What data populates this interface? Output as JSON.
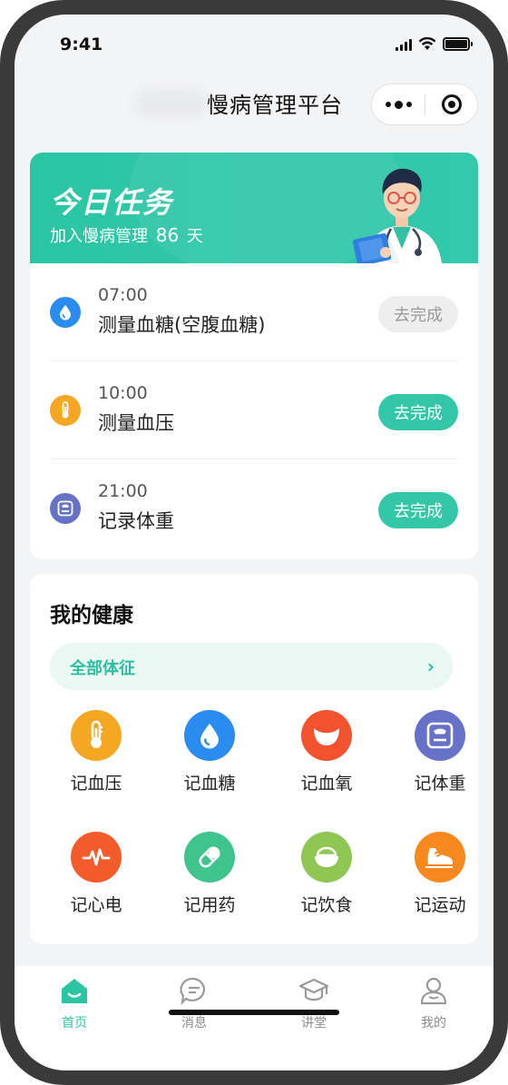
{
  "status_bar": {
    "time": "9:41"
  },
  "nav": {
    "title": "慢病管理平台"
  },
  "task_card": {
    "title": "今日任务",
    "subtitle_prefix": "加入慢病管理",
    "days": "86",
    "subtitle_suffix": "天",
    "tasks": [
      {
        "time": "07:00",
        "name": "测量血糖(空腹血糖)",
        "button": "去完成",
        "state": "done",
        "icon": "blood-drop-icon",
        "color": "#2b8cf0"
      },
      {
        "time": "10:00",
        "name": "测量血压",
        "button": "去完成",
        "state": "todo",
        "icon": "thermometer-icon",
        "color": "#f5a623"
      },
      {
        "time": "21:00",
        "name": "记录体重",
        "button": "去完成",
        "state": "todo",
        "icon": "scale-icon",
        "color": "#6572c7"
      }
    ]
  },
  "health": {
    "title": "我的健康",
    "all_signs": "全部体征",
    "items": [
      {
        "label": "记血压",
        "icon": "thermometer-icon",
        "color": "#f5a623"
      },
      {
        "label": "记血糖",
        "icon": "blood-drop-icon",
        "color": "#2b8cf0"
      },
      {
        "label": "记血氧",
        "icon": "oxygen-icon",
        "color": "#f2522e"
      },
      {
        "label": "记体重",
        "icon": "scale-icon",
        "color": "#6572c7"
      },
      {
        "label": "记心电",
        "icon": "heartbeat-icon",
        "color": "#f45b2a"
      },
      {
        "label": "记用药",
        "icon": "pill-icon",
        "color": "#3fc48e"
      },
      {
        "label": "记饮食",
        "icon": "rice-bowl-icon",
        "color": "#8fc654"
      },
      {
        "label": "记运动",
        "icon": "sneaker-icon",
        "color": "#f7891f"
      }
    ]
  },
  "tabs": [
    {
      "label": "首页",
      "icon": "home-icon",
      "active": true
    },
    {
      "label": "消息",
      "icon": "message-icon",
      "active": false
    },
    {
      "label": "讲堂",
      "icon": "graduation-cap-icon",
      "active": false
    },
    {
      "label": "我的",
      "icon": "user-icon",
      "active": false
    }
  ],
  "colors": {
    "accent": "#2cc5a4",
    "background": "#f3f4f6"
  }
}
